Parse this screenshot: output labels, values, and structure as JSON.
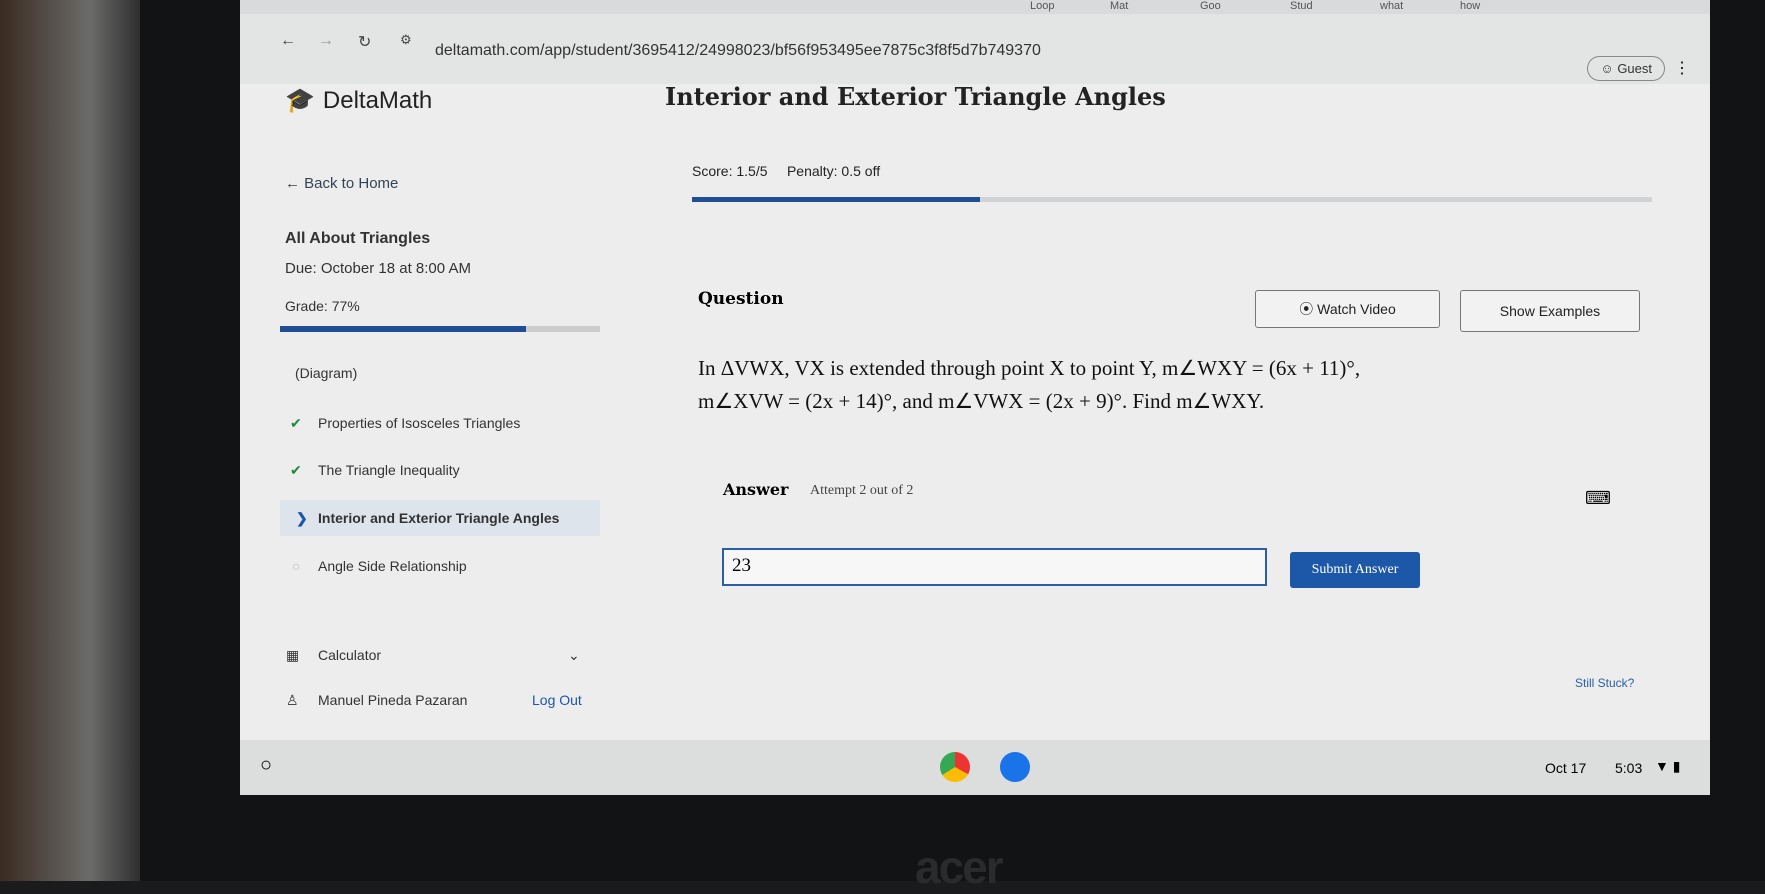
{
  "browser": {
    "tabs": [
      "Loop",
      "Mat",
      "Goo",
      "Stud",
      "what",
      "how"
    ],
    "url": "deltamath.com/app/student/3695412/24998023/bf56f953495ee7875c3f8f5d7b749370",
    "profile": "Guest"
  },
  "app": {
    "logo": "DeltaMath",
    "page_title": "Interior and Exterior Triangle Angles"
  },
  "sidebar": {
    "back": "Back to Home",
    "assignment": "All About Triangles",
    "due": "Due: October 18 at 8:00 AM",
    "grade": "Grade: 77%",
    "grade_progress": 0.77,
    "topics": [
      {
        "label": "(Diagram)",
        "status": "none"
      },
      {
        "label": "Properties of Isosceles Triangles",
        "status": "done"
      },
      {
        "label": "The Triangle Inequality",
        "status": "done"
      },
      {
        "label": "Interior and Exterior Triangle Angles",
        "status": "current"
      },
      {
        "label": "Angle Side Relationship",
        "status": "todo"
      }
    ],
    "calculator": "Calculator",
    "user": "Manuel Pineda Pazaran",
    "logout": "Log Out"
  },
  "main": {
    "score": "Score: 1.5/5",
    "penalty": "Penalty: 0.5 off",
    "score_progress": 0.3,
    "question_label": "Question",
    "watch_video": "Watch Video",
    "show_examples": "Show Examples",
    "question_line1": "In ΔVWX, VX is extended through point X to point Y, m∠WXY = (6x + 11)°,",
    "question_line2": "m∠XVW = (2x + 14)°, and m∠VWX = (2x + 9)°. Find m∠WXY.",
    "answer_label": "Answer",
    "attempt": "Attempt 2 out of 2",
    "answer_value": "23",
    "submit": "Submit Answer",
    "still_stuck": "Still Stuck?"
  },
  "shelf": {
    "date": "Oct 17",
    "time": "5:03"
  },
  "laptop_brand": "acer",
  "colors": {
    "accent": "#1d57a8",
    "progress": "#1f4e96"
  }
}
